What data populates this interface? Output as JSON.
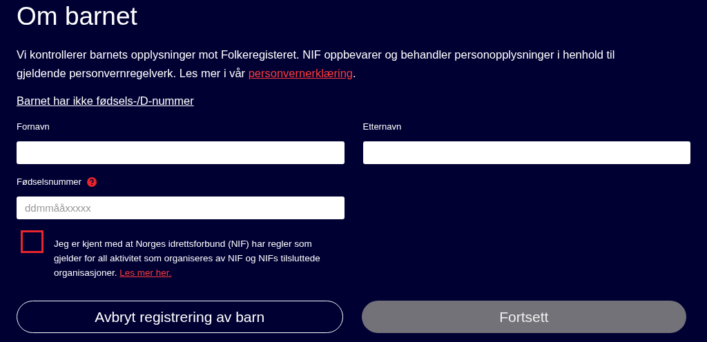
{
  "heading": "Om barnet",
  "intro": {
    "text": "Vi kontrollerer barnets opplysninger mot Folkeregisteret. NIF oppbevarer og behandler personopplysninger i henhold til gjeldende personvernregelverk. Les mer i vår ",
    "link": "personvernerklæring",
    "after": "."
  },
  "no_id_link": "Barnet har ikke fødsels-/D-nummer",
  "fields": [
    {
      "label": "Fornavn",
      "help": false
    },
    {
      "label": "Etternavn",
      "help": false
    },
    {
      "label": "Fødselsnummer",
      "placeholder": "ddmmååxxxxx",
      "help": true
    }
  ],
  "consent": {
    "checked": false,
    "text": "Jeg er kjent med at Norges idrettsforbund (NIF) har regler som gjelder for all aktivitet som organiseres av NIF og NIFs tilsluttede organisasjoner. ",
    "link": "Les mer her."
  },
  "buttons": [
    {
      "label": "Avbryt registrering av barn",
      "kind": "outline",
      "disabled": false
    },
    {
      "label": "Fortsett",
      "kind": "filled",
      "disabled": true
    }
  ]
}
